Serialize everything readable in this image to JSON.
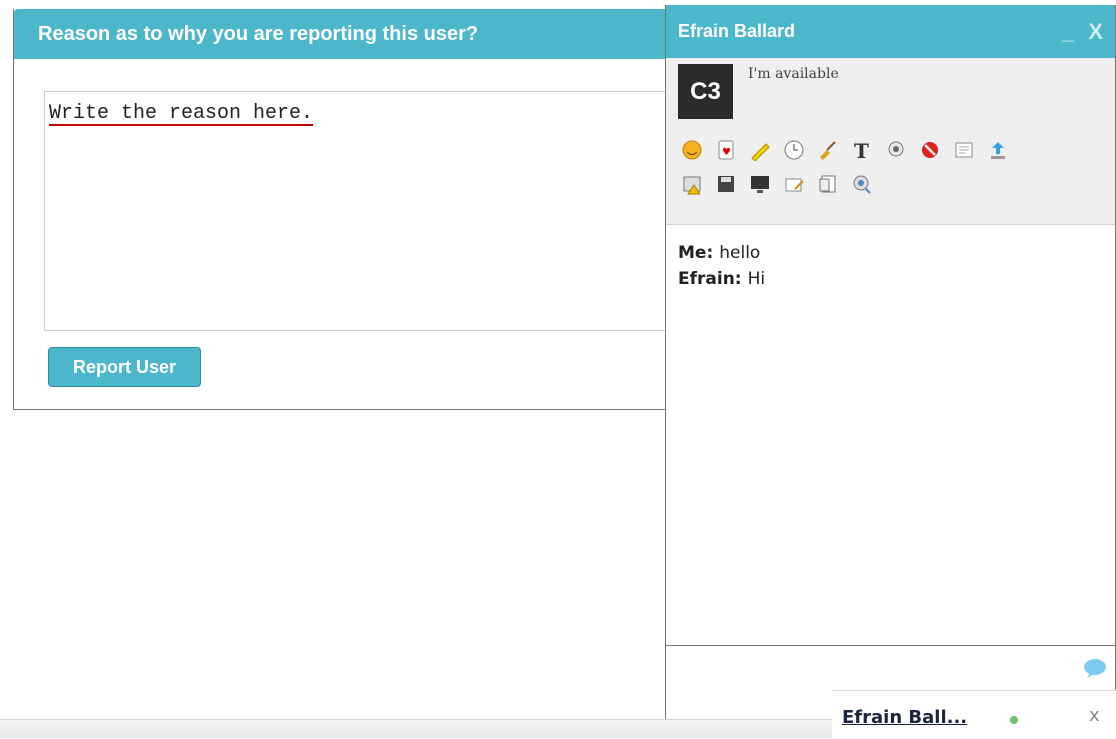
{
  "report_dialog": {
    "title": "Reason as to why you are reporting this user?",
    "textarea_text": "Write the reason here.",
    "button_label": "Report User"
  },
  "chat": {
    "contact_name": "Efrain Ballard",
    "controls": "_ X",
    "avatar_text": "C3",
    "status": "I'm available",
    "tools_row1": [
      "emoticon-icon",
      "games-icon",
      "pencil-icon",
      "clock-icon",
      "broom-icon",
      "text-format-icon",
      "webcam-icon",
      "block-icon",
      "transcript-icon",
      "upload-icon"
    ],
    "tools_row2": [
      "calendar-warning-icon",
      "save-icon",
      "screen-share-icon",
      "whiteboard-icon",
      "notes-icon",
      "video-call-icon"
    ],
    "messages": [
      {
        "sender": "Me:",
        "text": "hello"
      },
      {
        "sender": "Efrain:",
        "text": "Hi"
      }
    ]
  },
  "minimized_chat": {
    "name": "Efrain Ball...",
    "close": "x",
    "online_color": "#6cc46c"
  },
  "colors": {
    "accent": "#4cb6cb"
  }
}
